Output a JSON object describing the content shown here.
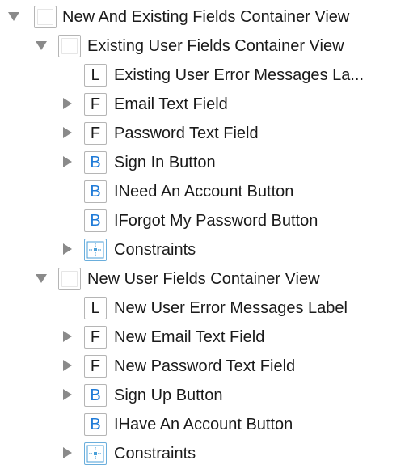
{
  "tree": {
    "rows": [
      {
        "label": "New And Existing Fields Container View",
        "icon_type": "view",
        "icon_letter": "",
        "disclosure": "expanded"
      },
      {
        "label": "Existing User Fields Container View",
        "icon_type": "view",
        "icon_letter": "",
        "disclosure": "expanded"
      },
      {
        "label": "Existing User Error Messages La...",
        "icon_type": "label",
        "icon_letter": "L",
        "disclosure": "none"
      },
      {
        "label": "Email Text Field",
        "icon_type": "text-field",
        "icon_letter": "F",
        "disclosure": "collapsed"
      },
      {
        "label": "Password Text Field",
        "icon_type": "text-field",
        "icon_letter": "F",
        "disclosure": "collapsed"
      },
      {
        "label": "Sign In Button",
        "icon_type": "button",
        "icon_letter": "B",
        "disclosure": "collapsed"
      },
      {
        "label": "INeed An Account Button",
        "icon_type": "button",
        "icon_letter": "B",
        "disclosure": "none"
      },
      {
        "label": "IForgot My Password Button",
        "icon_type": "button",
        "icon_letter": "B",
        "disclosure": "none"
      },
      {
        "label": "Constraints",
        "icon_type": "constraints",
        "icon_letter": "",
        "disclosure": "collapsed"
      },
      {
        "label": "New User Fields Container View",
        "icon_type": "view",
        "icon_letter": "",
        "disclosure": "expanded"
      },
      {
        "label": "New User Error Messages Label",
        "icon_type": "label",
        "icon_letter": "L",
        "disclosure": "none"
      },
      {
        "label": "New Email Text Field",
        "icon_type": "text-field",
        "icon_letter": "F",
        "disclosure": "collapsed"
      },
      {
        "label": "New Password Text Field",
        "icon_type": "text-field",
        "icon_letter": "F",
        "disclosure": "collapsed"
      },
      {
        "label": "Sign Up Button",
        "icon_type": "button",
        "icon_letter": "B",
        "disclosure": "collapsed"
      },
      {
        "label": "IHave An Account Button",
        "icon_type": "button",
        "icon_letter": "B",
        "disclosure": "none"
      },
      {
        "label": "Constraints",
        "icon_type": "constraints",
        "icon_letter": "",
        "disclosure": "collapsed"
      }
    ]
  },
  "colors": {
    "button_letter": "#1f7bd8",
    "constraints_icon": "#4a9fd8",
    "disclosure_triangle": "#8a8a8a"
  }
}
